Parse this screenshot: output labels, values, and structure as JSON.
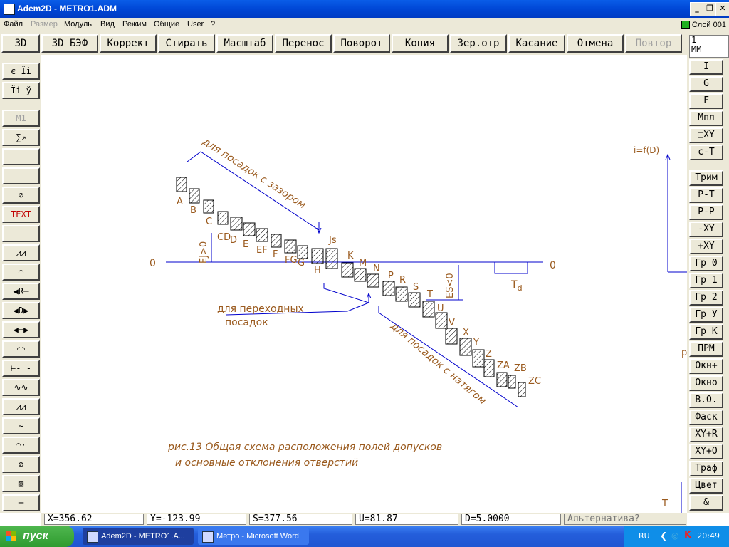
{
  "window": {
    "title": "Adem2D - METRO1.ADM"
  },
  "menu": [
    "Файл",
    "Размер",
    "Модуль",
    "Вид",
    "Режим",
    "Общие",
    "User",
    "?"
  ],
  "layer": "Слой 001",
  "toolbar": [
    "3D",
    "3D БЭФ",
    "Коррект",
    "Стирать",
    "Масштаб",
    "Перенос",
    "Поворот",
    "Копия",
    "Зер.отр",
    "Касание",
    "Отмена",
    "Повтор"
  ],
  "left_tools": {
    "t1": "є Їі",
    "t2": "Їі ў",
    "t3": "М1",
    "text": "TEXT"
  },
  "unit": {
    "value": "1",
    "label": "ММ"
  },
  "right_tools": [
    "I",
    "G",
    "F",
    "Мпл",
    "□XY",
    "с-Т",
    "Трим",
    "Р-Т",
    "Р-Р",
    "-XY",
    "+XY",
    "Гр 0",
    "Гр 1",
    "Гр 2",
    "Гр У",
    "Гр К",
    "ПРМ",
    "Окн+",
    "Окно",
    "В.О.",
    "Фаск",
    "XY+R",
    "XY+O",
    "Траф",
    "Цвет",
    "&"
  ],
  "drawing": {
    "zero_left": "0",
    "zero_right": "0",
    "upper_label": "для посадок с зазором",
    "middle_label_1": "для переходных",
    "middle_label_2": "посадок",
    "lower_label": "для посадок с натягом",
    "ei_label": "EJ>0",
    "es_label": "ES<0",
    "td_label": "T",
    "td_sub": "d",
    "right_func": "i=f(D)",
    "right_p": "р",
    "right_t": "Т",
    "caption_1": "рис.13  Общая схема расположения полей допусков",
    "caption_2": "и основные отклонения отверстий",
    "letters": [
      "A",
      "B",
      "C",
      "CD",
      "D",
      "E",
      "EF",
      "F",
      "FG",
      "G",
      "H",
      "Js",
      "K",
      "M",
      "N",
      "P",
      "R",
      "S",
      "T",
      "U",
      "V",
      "X",
      "Y",
      "Z",
      "ZA",
      "ZB",
      "ZC"
    ]
  },
  "status": {
    "x": "X=356.62",
    "y": "Y=-123.99",
    "s": "S=377.56",
    "u": "U=81.87",
    "d": "D=5.0000",
    "alt": "Альтернатива?"
  },
  "taskbar": {
    "start": "пуск",
    "task1": "Adem2D - METRO1.A...",
    "task2": "Метро - Microsoft Word",
    "lang": "RU",
    "clock": "20:49"
  }
}
